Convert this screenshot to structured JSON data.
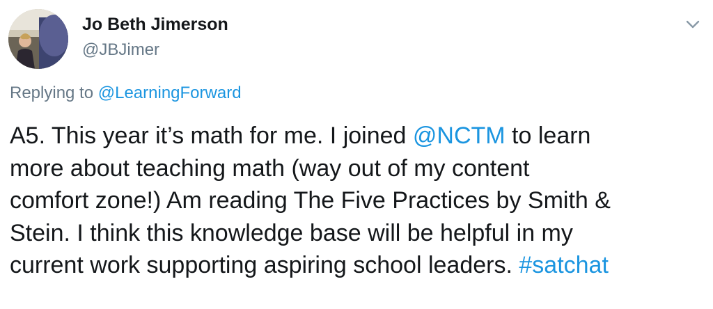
{
  "author": {
    "display_name": "Jo Beth Jimerson",
    "handle": "@JBJimer",
    "avatar_icon": "profile-photo"
  },
  "menu": {
    "icon": "chevron-down-icon"
  },
  "reply": {
    "prefix": "Replying to ",
    "to_handle": "@LearningForward"
  },
  "tweet": {
    "line1_a": "A5. This year it’s math for me. I joined ",
    "mention": "@NCTM",
    "line1_b": " to learn",
    "line2": "more about teaching math (way out of my content",
    "line3": "comfort zone!) Am reading The Five Practices by Smith &",
    "line4": "Stein. I think this knowledge base will be helpful in my",
    "line5_a": "current work supporting aspiring school leaders. ",
    "hashtag": "#satchat"
  },
  "colors": {
    "link": "#1b95e0",
    "secondary_text": "#657786",
    "primary_text": "#14171a"
  }
}
